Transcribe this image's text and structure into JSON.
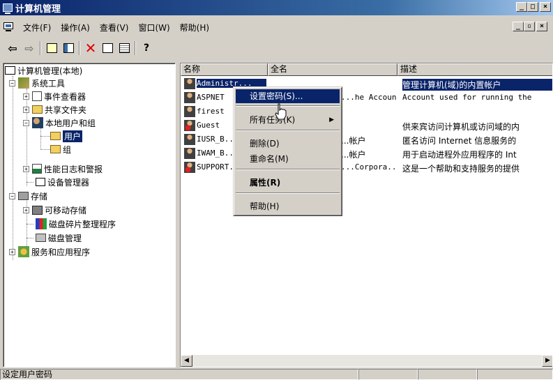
{
  "window": {
    "title": "计算机管理"
  },
  "menubar": {
    "items": [
      "文件(F)",
      "操作(A)",
      "查看(V)",
      "窗口(W)",
      "帮助(H)"
    ]
  },
  "tree": {
    "root": "计算机管理(本地)",
    "system_tools": "系统工具",
    "event_viewer": "事件查看器",
    "shared_folders": "共享文件夹",
    "local_users_groups": "本地用户和组",
    "users": "用户",
    "groups": "组",
    "perf_logs": "性能日志和警报",
    "device_manager": "设备管理器",
    "storage": "存储",
    "removable_storage": "可移动存储",
    "defrag": "磁盘碎片整理程序",
    "disk_mgmt": "磁盘管理",
    "services_apps": "服务和应用程序"
  },
  "list": {
    "headers": [
      "名称",
      "全名",
      "描述"
    ],
    "rows": [
      {
        "name": "Administr...",
        "fullname": "",
        "desc": "管理计算机(域)的内置帐户",
        "disabled": false
      },
      {
        "name": "ASPNET",
        "fullname": "...he Account",
        "desc": "Account used for running the",
        "disabled": false
      },
      {
        "name": "firest",
        "fullname": "",
        "desc": "",
        "disabled": false
      },
      {
        "name": "Guest",
        "fullname": "",
        "desc": "供来宾访问计算机或访问域的内",
        "disabled": true
      },
      {
        "name": "IUSR_B...",
        "fullname": "...帐户",
        "desc": "匿名访问 Internet 信息服务的",
        "disabled": false
      },
      {
        "name": "IWAM_B...",
        "fullname": "...帐户",
        "desc": "用于启动进程外应用程序的 Int",
        "disabled": false
      },
      {
        "name": "SUPPORT...",
        "fullname": "...Corpora...",
        "desc": "这是一个帮助和支持服务的提供",
        "disabled": true
      }
    ]
  },
  "context_menu": {
    "set_password": "设置密码(S)...",
    "all_tasks": "所有任务(K)",
    "delete": "删除(D)",
    "rename": "重命名(M)",
    "properties": "属性(R)",
    "help": "帮助(H)"
  },
  "status": {
    "text": "设定用户密码"
  },
  "colors": {
    "title_start": "#0a246a",
    "title_end": "#a6caf0",
    "selection": "#0a246a",
    "face": "#d4d0c8"
  }
}
